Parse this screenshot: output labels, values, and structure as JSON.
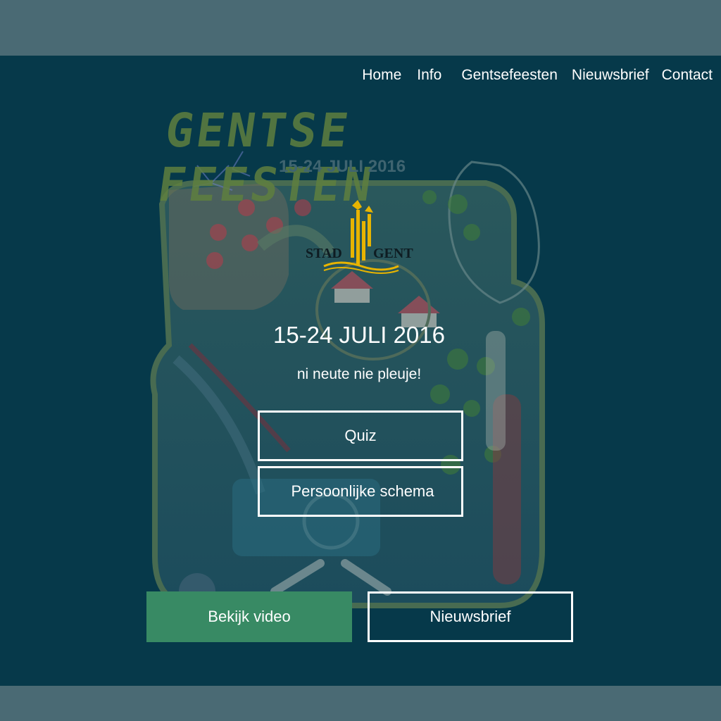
{
  "nav": {
    "items": [
      "Home",
      "Info",
      "Gentsefeesten",
      "Nieuwsbrief",
      "Contact"
    ]
  },
  "poster": {
    "title": "GENTSE FEESTEN",
    "date": "15-24 JULI 2016"
  },
  "logo": {
    "left_text": "STAD",
    "right_text": "GENT",
    "color": "#e8b400"
  },
  "hero": {
    "headline": "15-24 JULI 2016",
    "tagline": "ni neute nie pleuje!"
  },
  "buttons": {
    "quiz": "Quiz",
    "schema": "Persoonlijke schema",
    "video": "Bekijk video",
    "newsletter": "Nieuwsbrief"
  },
  "colors": {
    "background_band": "#4a6a74",
    "hero_bg": "#06394a",
    "video_button": "#388a64"
  }
}
